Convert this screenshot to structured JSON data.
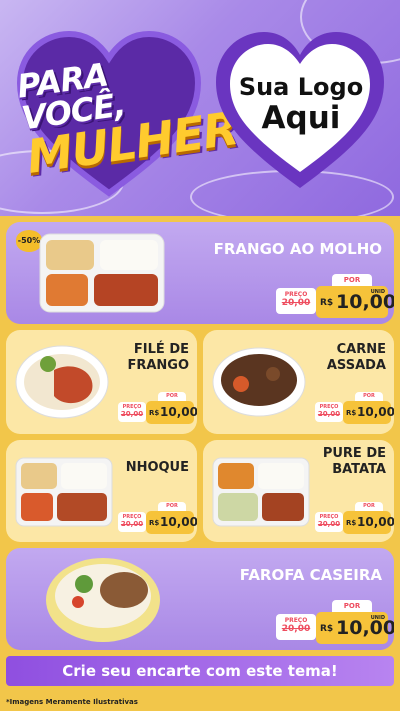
{
  "hero": {
    "title_line1": "PARA VOCÊ,",
    "title_line2": "MULHER",
    "logo_line1": "Sua Logo",
    "logo_line2": "Aqui"
  },
  "discount_badge": "-50%",
  "price_labels": {
    "old_label": "PREÇO",
    "old_value": "20,00",
    "por": "POR",
    "currency": "R$",
    "new_value": "10,00",
    "unit": "UNID"
  },
  "products": [
    {
      "name": "FRANGO AO MOLHO"
    },
    {
      "name": "FILÉ DE\nFRANGO"
    },
    {
      "name": "CARNE\nASSADA"
    },
    {
      "name": "NHOQUE"
    },
    {
      "name": "PURE DE\nBATATA"
    },
    {
      "name": "FAROFA CASEIRA"
    }
  ],
  "footer": {
    "cta": "Crie seu encarte com este tema!",
    "disclaimer": "*Imagens Meramente Ilustrativas"
  },
  "colors": {
    "purple": "#a988e6",
    "yellow": "#f2c64a",
    "card_yellow": "#fce7a6",
    "price_red": "#ee4d5f",
    "footer_purple": "#8f4fe0"
  }
}
